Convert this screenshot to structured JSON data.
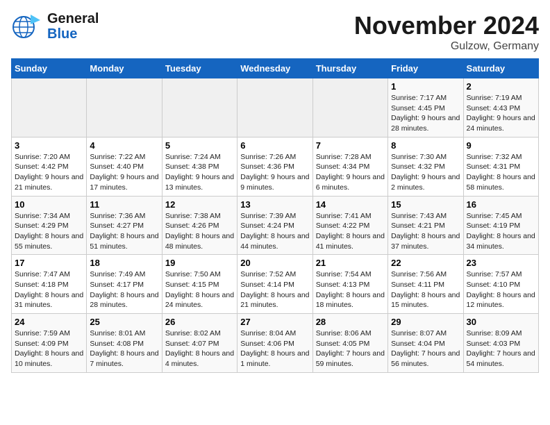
{
  "header": {
    "logo_general": "General",
    "logo_blue": "Blue",
    "month": "November 2024",
    "location": "Gulzow, Germany"
  },
  "weekdays": [
    "Sunday",
    "Monday",
    "Tuesday",
    "Wednesday",
    "Thursday",
    "Friday",
    "Saturday"
  ],
  "weeks": [
    [
      {
        "day": "",
        "info": ""
      },
      {
        "day": "",
        "info": ""
      },
      {
        "day": "",
        "info": ""
      },
      {
        "day": "",
        "info": ""
      },
      {
        "day": "",
        "info": ""
      },
      {
        "day": "1",
        "info": "Sunrise: 7:17 AM\nSunset: 4:45 PM\nDaylight: 9 hours and 28 minutes."
      },
      {
        "day": "2",
        "info": "Sunrise: 7:19 AM\nSunset: 4:43 PM\nDaylight: 9 hours and 24 minutes."
      }
    ],
    [
      {
        "day": "3",
        "info": "Sunrise: 7:20 AM\nSunset: 4:42 PM\nDaylight: 9 hours and 21 minutes."
      },
      {
        "day": "4",
        "info": "Sunrise: 7:22 AM\nSunset: 4:40 PM\nDaylight: 9 hours and 17 minutes."
      },
      {
        "day": "5",
        "info": "Sunrise: 7:24 AM\nSunset: 4:38 PM\nDaylight: 9 hours and 13 minutes."
      },
      {
        "day": "6",
        "info": "Sunrise: 7:26 AM\nSunset: 4:36 PM\nDaylight: 9 hours and 9 minutes."
      },
      {
        "day": "7",
        "info": "Sunrise: 7:28 AM\nSunset: 4:34 PM\nDaylight: 9 hours and 6 minutes."
      },
      {
        "day": "8",
        "info": "Sunrise: 7:30 AM\nSunset: 4:32 PM\nDaylight: 9 hours and 2 minutes."
      },
      {
        "day": "9",
        "info": "Sunrise: 7:32 AM\nSunset: 4:31 PM\nDaylight: 8 hours and 58 minutes."
      }
    ],
    [
      {
        "day": "10",
        "info": "Sunrise: 7:34 AM\nSunset: 4:29 PM\nDaylight: 8 hours and 55 minutes."
      },
      {
        "day": "11",
        "info": "Sunrise: 7:36 AM\nSunset: 4:27 PM\nDaylight: 8 hours and 51 minutes."
      },
      {
        "day": "12",
        "info": "Sunrise: 7:38 AM\nSunset: 4:26 PM\nDaylight: 8 hours and 48 minutes."
      },
      {
        "day": "13",
        "info": "Sunrise: 7:39 AM\nSunset: 4:24 PM\nDaylight: 8 hours and 44 minutes."
      },
      {
        "day": "14",
        "info": "Sunrise: 7:41 AM\nSunset: 4:22 PM\nDaylight: 8 hours and 41 minutes."
      },
      {
        "day": "15",
        "info": "Sunrise: 7:43 AM\nSunset: 4:21 PM\nDaylight: 8 hours and 37 minutes."
      },
      {
        "day": "16",
        "info": "Sunrise: 7:45 AM\nSunset: 4:19 PM\nDaylight: 8 hours and 34 minutes."
      }
    ],
    [
      {
        "day": "17",
        "info": "Sunrise: 7:47 AM\nSunset: 4:18 PM\nDaylight: 8 hours and 31 minutes."
      },
      {
        "day": "18",
        "info": "Sunrise: 7:49 AM\nSunset: 4:17 PM\nDaylight: 8 hours and 28 minutes."
      },
      {
        "day": "19",
        "info": "Sunrise: 7:50 AM\nSunset: 4:15 PM\nDaylight: 8 hours and 24 minutes."
      },
      {
        "day": "20",
        "info": "Sunrise: 7:52 AM\nSunset: 4:14 PM\nDaylight: 8 hours and 21 minutes."
      },
      {
        "day": "21",
        "info": "Sunrise: 7:54 AM\nSunset: 4:13 PM\nDaylight: 8 hours and 18 minutes."
      },
      {
        "day": "22",
        "info": "Sunrise: 7:56 AM\nSunset: 4:11 PM\nDaylight: 8 hours and 15 minutes."
      },
      {
        "day": "23",
        "info": "Sunrise: 7:57 AM\nSunset: 4:10 PM\nDaylight: 8 hours and 12 minutes."
      }
    ],
    [
      {
        "day": "24",
        "info": "Sunrise: 7:59 AM\nSunset: 4:09 PM\nDaylight: 8 hours and 10 minutes."
      },
      {
        "day": "25",
        "info": "Sunrise: 8:01 AM\nSunset: 4:08 PM\nDaylight: 8 hours and 7 minutes."
      },
      {
        "day": "26",
        "info": "Sunrise: 8:02 AM\nSunset: 4:07 PM\nDaylight: 8 hours and 4 minutes."
      },
      {
        "day": "27",
        "info": "Sunrise: 8:04 AM\nSunset: 4:06 PM\nDaylight: 8 hours and 1 minute."
      },
      {
        "day": "28",
        "info": "Sunrise: 8:06 AM\nSunset: 4:05 PM\nDaylight: 7 hours and 59 minutes."
      },
      {
        "day": "29",
        "info": "Sunrise: 8:07 AM\nSunset: 4:04 PM\nDaylight: 7 hours and 56 minutes."
      },
      {
        "day": "30",
        "info": "Sunrise: 8:09 AM\nSunset: 4:03 PM\nDaylight: 7 hours and 54 minutes."
      }
    ]
  ]
}
